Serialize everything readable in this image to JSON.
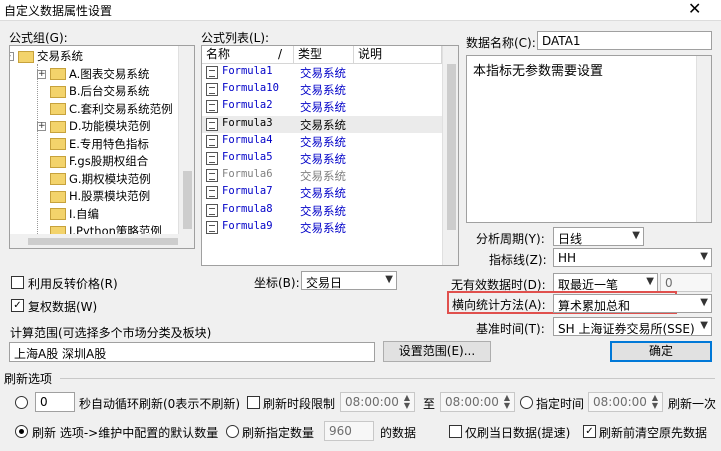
{
  "window": {
    "title": "自定义数据属性设置",
    "close_glyph": "✕"
  },
  "formula_group": {
    "label": "公式组(G):",
    "tree": [
      {
        "label": "交易系统",
        "expander": "-"
      },
      {
        "label": "A.图表交易系统",
        "expander": "+"
      },
      {
        "label": "B.后台交易系统",
        "expander": ""
      },
      {
        "label": "C.套利交易系统范例",
        "expander": ""
      },
      {
        "label": "D.功能模块范例",
        "expander": "+"
      },
      {
        "label": "E.专用特色指标",
        "expander": ""
      },
      {
        "label": "F.gs股期权组合",
        "expander": ""
      },
      {
        "label": "G.期权模块范例",
        "expander": ""
      },
      {
        "label": "H.股票模块范例",
        "expander": ""
      },
      {
        "label": "I.自编",
        "expander": ""
      },
      {
        "label": "J.Python策略范例",
        "expander": ""
      }
    ]
  },
  "formula_list": {
    "label": "公式列表(L):",
    "columns": [
      "名称",
      "/",
      "类型",
      "说明"
    ],
    "rows": [
      {
        "name": "Formula1",
        "type": "交易系统"
      },
      {
        "name": "Formula10",
        "type": "交易系统"
      },
      {
        "name": "Formula2",
        "type": "交易系统"
      },
      {
        "name": "Formula3",
        "type": "交易系统"
      },
      {
        "name": "Formula4",
        "type": "交易系统"
      },
      {
        "name": "Formula5",
        "type": "交易系统"
      },
      {
        "name": "Formula6",
        "type": "交易系统"
      },
      {
        "name": "Formula7",
        "type": "交易系统"
      },
      {
        "name": "Formula8",
        "type": "交易系统"
      },
      {
        "name": "Formula9",
        "type": "交易系统"
      }
    ]
  },
  "data_name": {
    "label": "数据名称(C):",
    "value": "DATA1",
    "description": "本指标无参数需要设置"
  },
  "analysis_period": {
    "label": "分析周期(Y):",
    "value": "日线"
  },
  "indicator_line": {
    "label": "指标线(Z):",
    "value": "HH"
  },
  "invalid_data": {
    "label": "无有效数据时(D):",
    "value": "取最近一笔",
    "number": "0"
  },
  "horizontal_stat": {
    "label": "横向统计方法(A):",
    "value": "算术累加总和"
  },
  "base_time": {
    "label": "基准时间(T):",
    "value": "SH 上海证券交易所(SSE)"
  },
  "coordinate": {
    "label": "坐标(B):",
    "value": "交易日"
  },
  "reverse_price": {
    "label": "利用反转价格(R)",
    "checked": false
  },
  "restore_rights": {
    "label": "复权数据(W)",
    "checked": true
  },
  "calc_range": {
    "label": "计算范围(可选择多个市场分类及板块)",
    "value": "上海A股  深圳A股",
    "button": "设置范围(E)..."
  },
  "ok_button": "确定",
  "refresh": {
    "section_label": "刷新选项",
    "seconds_value": "0",
    "seconds_text": "秒自动循环刷新(0表示不刷新)",
    "period_limit_label": "刷新时段限制",
    "time_from": "08:00:00",
    "to_label": "至",
    "time_to": "08:00:00",
    "specified_time_label": "指定时间",
    "time_specified": "08:00:00",
    "refresh_once_label": "刷新一次",
    "radio_refresh_label": "刷新 选项->维护中配置的默认数量",
    "radio_count_label": "刷新指定数量",
    "count_value": "960",
    "count_suffix": "的数据",
    "only_today_label": "仅刷当日数据(提速)",
    "clear_before_label": "刷新前清空原先数据"
  },
  "colors": {
    "highlight_box": "#e0504d",
    "link_blue": "#0000c8",
    "default_button": "#0078d7"
  }
}
